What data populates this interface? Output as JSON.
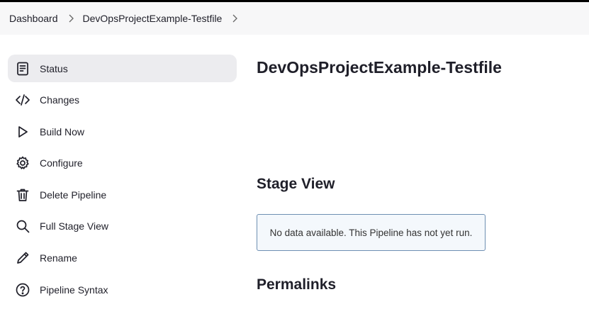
{
  "breadcrumb": {
    "items": [
      "Dashboard",
      "DevOpsProjectExample-Testfile"
    ]
  },
  "sidebar": {
    "items": [
      {
        "label": "Status",
        "icon": "status-doc-icon",
        "active": true
      },
      {
        "label": "Changes",
        "icon": "code-icon"
      },
      {
        "label": "Build Now",
        "icon": "play-icon"
      },
      {
        "label": "Configure",
        "icon": "gear-icon"
      },
      {
        "label": "Delete Pipeline",
        "icon": "trash-icon"
      },
      {
        "label": "Full Stage View",
        "icon": "search-icon"
      },
      {
        "label": "Rename",
        "icon": "pencil-icon"
      },
      {
        "label": "Pipeline Syntax",
        "icon": "help-icon"
      }
    ]
  },
  "main": {
    "title": "DevOpsProjectExample-Testfile",
    "stage_view_heading": "Stage View",
    "stage_view_empty": "No data available. This Pipeline has not yet run.",
    "permalinks_heading": "Permalinks"
  },
  "colors": {
    "breadcrumb_bg": "#f7f7f8",
    "active_item_bg": "#ececef",
    "notice_border": "#6e8fb3",
    "notice_bg": "#f4f8fc"
  }
}
